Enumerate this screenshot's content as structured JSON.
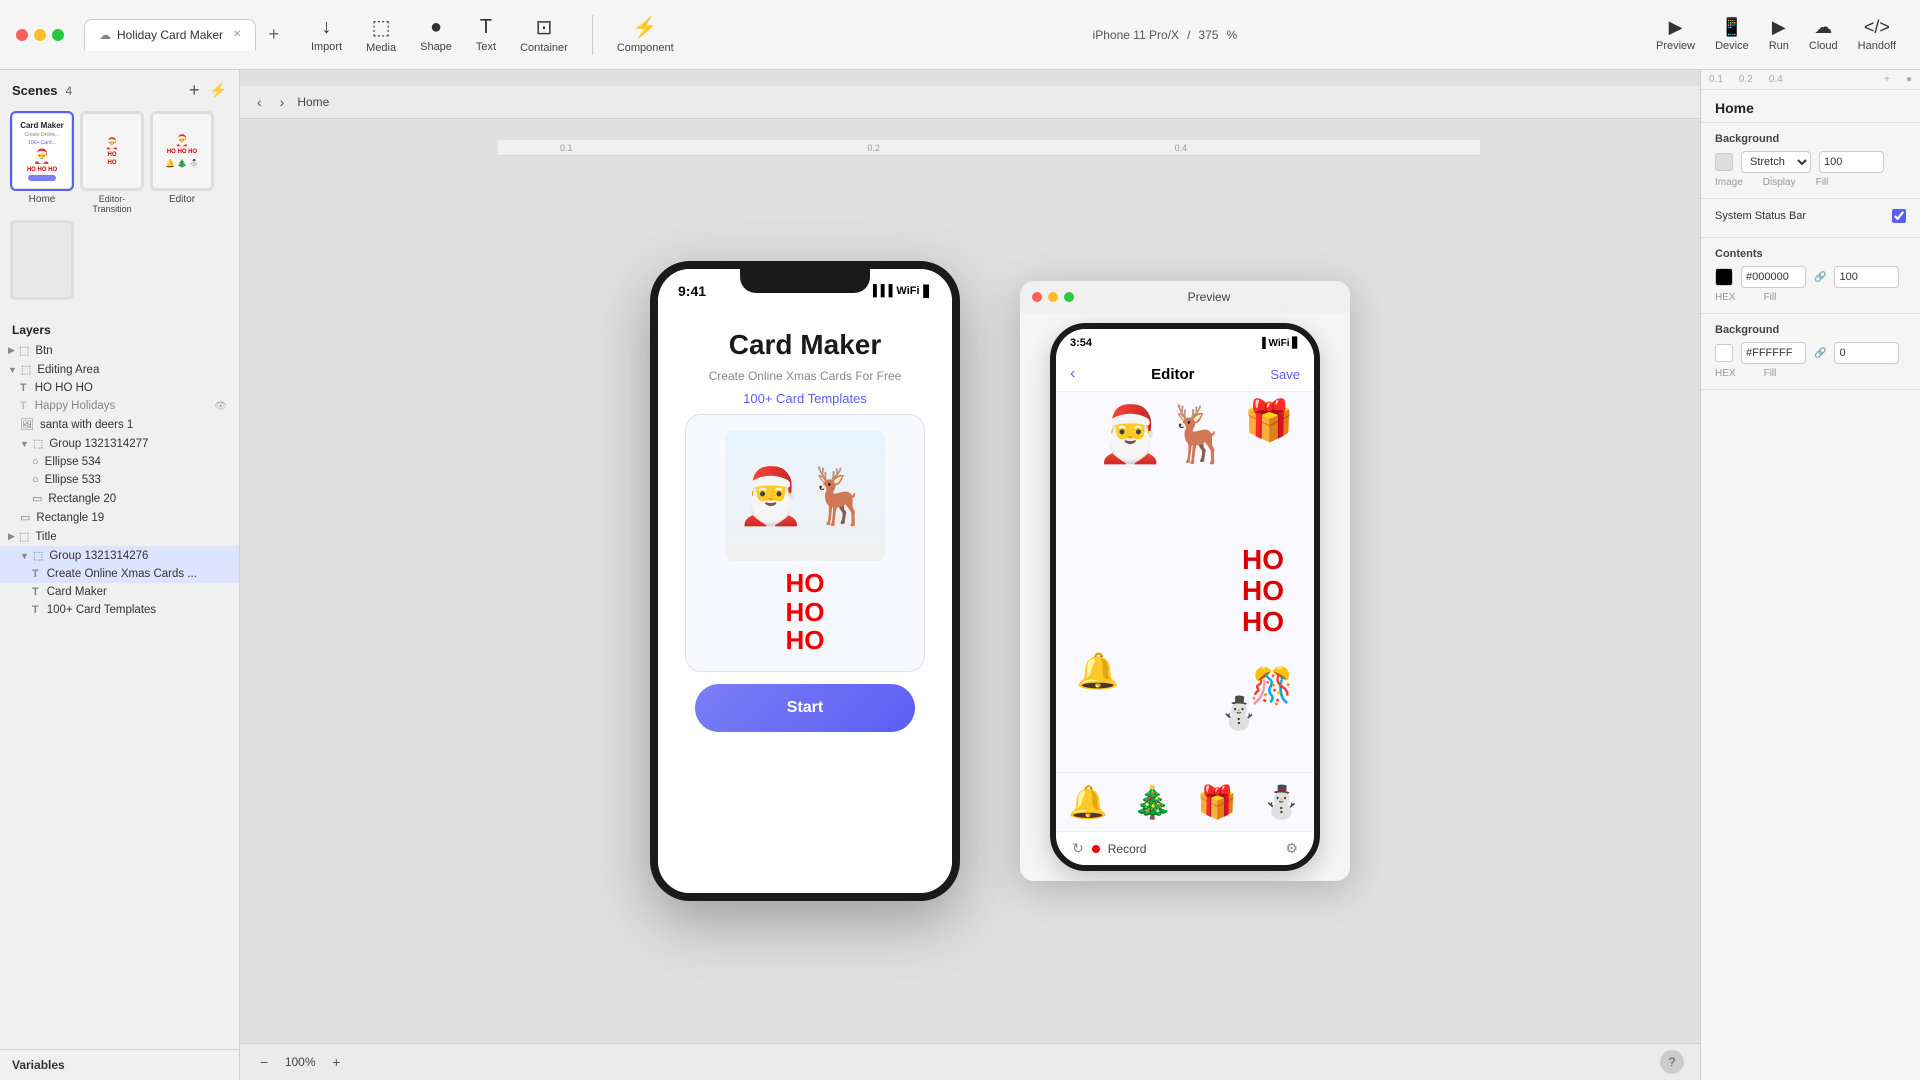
{
  "window": {
    "title": "Holiday Card Maker",
    "tab_label": "Holiday Card Maker"
  },
  "toolbar": {
    "import_label": "Import",
    "media_label": "Media",
    "shape_label": "Shape",
    "text_label": "Text",
    "container_label": "Container",
    "component_label": "Component",
    "preview_label": "Preview",
    "device_label": "Device",
    "run_label": "Run",
    "cloud_label": "Cloud",
    "handoff_label": "Handoff"
  },
  "device_bar": {
    "label": "iPhone 11 Pro/X",
    "zoom": "375",
    "percent": "%"
  },
  "scenes": {
    "title": "Scenes",
    "count": "4",
    "items": [
      {
        "label": "Home"
      },
      {
        "label": "Editor-Transition"
      },
      {
        "label": "Editor"
      },
      {
        "label": ""
      }
    ]
  },
  "layers": {
    "title": "Layers",
    "items": [
      {
        "name": "Btn",
        "indent": 0,
        "icon": "group",
        "expanded": false
      },
      {
        "name": "Editing Area",
        "indent": 0,
        "icon": "group",
        "expanded": true
      },
      {
        "name": "HO HO HO",
        "indent": 1,
        "icon": "T"
      },
      {
        "name": "Happy Holidays",
        "indent": 1,
        "icon": "T",
        "has_arrow": true
      },
      {
        "name": "santa with deers 1",
        "indent": 1,
        "icon": "img"
      },
      {
        "name": "Group 1321314277",
        "indent": 1,
        "icon": "group",
        "expanded": true
      },
      {
        "name": "Ellipse 534",
        "indent": 2,
        "icon": "shape"
      },
      {
        "name": "Ellipse 533",
        "indent": 2,
        "icon": "shape"
      },
      {
        "name": "Rectangle 20",
        "indent": 2,
        "icon": "rect"
      },
      {
        "name": "Rectangle 19",
        "indent": 1,
        "icon": "rect"
      },
      {
        "name": "Title",
        "indent": 0,
        "icon": "group",
        "expanded": false
      },
      {
        "name": "Group 1321314276",
        "indent": 1,
        "icon": "group",
        "expanded": true,
        "selected": true
      },
      {
        "name": "Create Online Xmas Cards ...",
        "indent": 2,
        "icon": "T",
        "selected": true
      },
      {
        "name": "Card Maker",
        "indent": 2,
        "icon": "T"
      },
      {
        "name": "100+ Card Templates",
        "indent": 2,
        "icon": "T"
      }
    ]
  },
  "variables": {
    "label": "Variables"
  },
  "canvas": {
    "scene_label": "Home",
    "zoom_value": "100%"
  },
  "phone_app": {
    "time": "9:41",
    "title": "Card Maker",
    "subtitle": "Create Online Xmas Cards For Free",
    "templates_link": "100+ Card Templates",
    "ho_line1": "HO",
    "ho_line2": "HO",
    "ho_line3": "HO",
    "start_button": "Start"
  },
  "preview_panel": {
    "title": "Preview",
    "phone_time": "3:54",
    "editor_title": "Editor",
    "save_label": "Save",
    "back_icon": "‹",
    "ho1": "HO",
    "ho2": "HO",
    "ho3": "HO",
    "record_label": "Record",
    "stickers": [
      "🔔",
      "🎄",
      "🎁",
      "⛄"
    ]
  },
  "right_panel": {
    "title": "Home",
    "background_section": "Background",
    "image_label": "Image",
    "display_label": "Display",
    "display_option": "Stretch",
    "fill_label": "Fill",
    "fill_value": "100",
    "status_bar_label": "System Status Bar",
    "contents_section": "Contents",
    "contents_color": "#000000",
    "contents_fill": "100",
    "contents_hex": "HEX",
    "contents_fill_label": "Fill",
    "background_section2": "Background",
    "bg_color": "#FFFFFF",
    "bg_value": "0",
    "bg_hex": "HEX",
    "bg_fill_label": "Fill"
  },
  "ruler": {
    "ticks": [
      "0.1",
      "0.2",
      "0.4"
    ]
  }
}
